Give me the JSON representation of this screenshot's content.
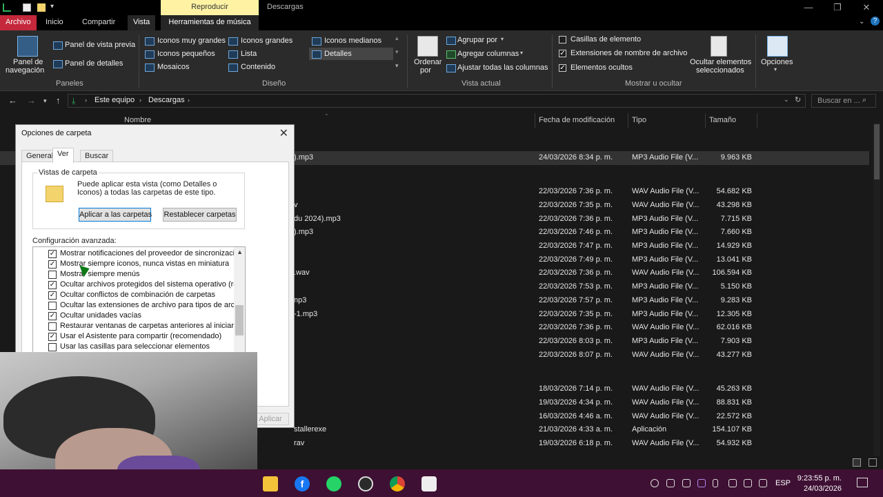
{
  "titlebar": {
    "context_group": "Reproducir",
    "window_title": "Descargas"
  },
  "tabs": {
    "file": "Archivo",
    "home": "Inicio",
    "share": "Compartir",
    "view": "Vista",
    "music_tools": "Herramientas de música"
  },
  "ribbon": {
    "panes": {
      "nav_pane_1": "Panel de",
      "nav_pane_2": "navegación",
      "preview": "Panel de vista previa",
      "details": "Panel de detalles",
      "group": "Paneles"
    },
    "layout": {
      "extra_large": "Iconos muy grandes",
      "large": "Iconos grandes",
      "medium": "Iconos medianos",
      "small": "Iconos pequeños",
      "list": "Lista",
      "details": "Detalles",
      "tiles": "Mosaicos",
      "content": "Contenido",
      "group": "Diseño"
    },
    "current_view": {
      "sort_1": "Ordenar",
      "sort_2": "por",
      "group_by": "Agrupar por",
      "add_columns": "Agregar columnas",
      "fit_columns": "Ajustar todas las columnas",
      "group": "Vista actual"
    },
    "show_hide": {
      "item_checkboxes": "Casillas de elemento",
      "file_extensions": "Extensiones de nombre de archivo",
      "hidden_items": "Elementos ocultos",
      "hide_selected_1": "Ocultar elementos",
      "hide_selected_2": "seleccionados",
      "group": "Mostrar u ocultar",
      "item_checkboxes_checked": false,
      "file_extensions_checked": true,
      "hidden_items_checked": true
    },
    "options": "Opciones"
  },
  "address": {
    "crumbs": [
      "Este equipo",
      "Descargas"
    ],
    "search_placeholder": "Buscar en ..."
  },
  "columns": {
    "name": "Nombre",
    "date": "Fecha de modificación",
    "type": "Tipo",
    "size": "Tamaño"
  },
  "rows": [
    {
      "name": ").mp3",
      "date": "24/03/2026 8:34 p. m.",
      "type": "MP3 Audio File (V...",
      "size": "9.963 KB"
    },
    {
      "name": "",
      "date": "22/03/2026 7:36 p. m.",
      "type": "WAV Audio File (V...",
      "size": "54.682 KB"
    },
    {
      "name": "v",
      "date": "22/03/2026 7:35 p. m.",
      "type": "WAV Audio File (V...",
      "size": "43.298 KB"
    },
    {
      "name": "du 2024).mp3",
      "date": "22/03/2026 7:36 p. m.",
      "type": "MP3 Audio File (V...",
      "size": "7.715 KB"
    },
    {
      "name": ").mp3",
      "date": "22/03/2026 7:46 p. m.",
      "type": "MP3 Audio File (V...",
      "size": "7.660 KB"
    },
    {
      "name": "",
      "date": "22/03/2026 7:47 p. m.",
      "type": "MP3 Audio File (V...",
      "size": "14.929 KB"
    },
    {
      "name": "",
      "date": "22/03/2026 7:49 p. m.",
      "type": "MP3 Audio File (V...",
      "size": "13.041 KB"
    },
    {
      "name": ".wav",
      "date": "22/03/2026 7:36 p. m.",
      "type": "WAV Audio File (V...",
      "size": "106.594 KB"
    },
    {
      "name": "",
      "date": "22/03/2026 7:53 p. m.",
      "type": "MP3 Audio File (V...",
      "size": "5.150 KB"
    },
    {
      "name": "np3",
      "date": "22/03/2026 7:57 p. m.",
      "type": "MP3 Audio File (V...",
      "size": "9.283 KB"
    },
    {
      "name": "-1.mp3",
      "date": "22/03/2026 7:35 p. m.",
      "type": "MP3 Audio File (V...",
      "size": "12.305 KB"
    },
    {
      "name": "",
      "date": "22/03/2026 7:36 p. m.",
      "type": "WAV Audio File (V...",
      "size": "62.016 KB"
    },
    {
      "name": "",
      "date": "22/03/2026 8:03 p. m.",
      "type": "MP3 Audio File (V...",
      "size": "7.903 KB"
    },
    {
      "name": "",
      "date": "22/03/2026 8:07 p. m.",
      "type": "WAV Audio File (V...",
      "size": "43.277 KB"
    },
    {
      "name": "",
      "date": "18/03/2026 7:14 p. m.",
      "type": "WAV Audio File (V...",
      "size": "45.263 KB"
    },
    {
      "name": "",
      "date": "19/03/2026 4:34 p. m.",
      "type": "WAV Audio File (V...",
      "size": "88.831 KB"
    },
    {
      "name": "",
      "date": "16/03/2026 4:46 a. m.",
      "type": "WAV Audio File (V...",
      "size": "22.572 KB"
    },
    {
      "name": "stallerexe",
      "date": "21/03/2026 4:33 a. m.",
      "type": "Aplicación",
      "size": "154.107 KB"
    },
    {
      "name": "rav",
      "date": "19/03/2026 6:18 p. m.",
      "type": "WAV Audio File (V...",
      "size": "54.932 KB"
    }
  ],
  "dialog": {
    "title": "Opciones de carpeta",
    "tabs": [
      "General",
      "Ver",
      "Buscar"
    ],
    "folder_views_legend": "Vistas de carpeta",
    "folder_views_text": "Puede aplicar esta vista (como Detalles o Iconos) a todas las carpetas de este tipo.",
    "apply_to_folders": "Aplicar a las carpetas",
    "reset_folders": "Restablecer carpetas",
    "advanced_label": "Configuración avanzada:",
    "advanced_items": [
      {
        "label": "Mostrar notificaciones del proveedor de sincronización",
        "checked": true
      },
      {
        "label": "Mostrar siempre iconos, nunca vistas en miniatura",
        "checked": true
      },
      {
        "label": "Mostrar siempre menús",
        "checked": false
      },
      {
        "label": "Ocultar archivos protegidos del sistema operativo (recome",
        "checked": true
      },
      {
        "label": "Ocultar conflictos de combinación de carpetas",
        "checked": true
      },
      {
        "label": "Ocultar las extensiones de archivo para tipos de archivo c",
        "checked": false
      },
      {
        "label": "Ocultar unidades vacías",
        "checked": true
      },
      {
        "label": "Restaurar ventanas de carpetas anteriores al iniciar sesió",
        "checked": false
      },
      {
        "label": "Usar el Asistente para compartir (recomendado)",
        "checked": true
      },
      {
        "label": "Usar las casillas para seleccionar elementos",
        "checked": false
      }
    ],
    "apply_button": "Aplicar"
  },
  "taskbar": {
    "lang": "ESP",
    "time": "9:23:55 p. m.",
    "date": "24/03/2026"
  },
  "colors": {
    "file_tab": "#c4283a",
    "taskbar": "#3e1033",
    "context_group": "#fff3a3"
  }
}
